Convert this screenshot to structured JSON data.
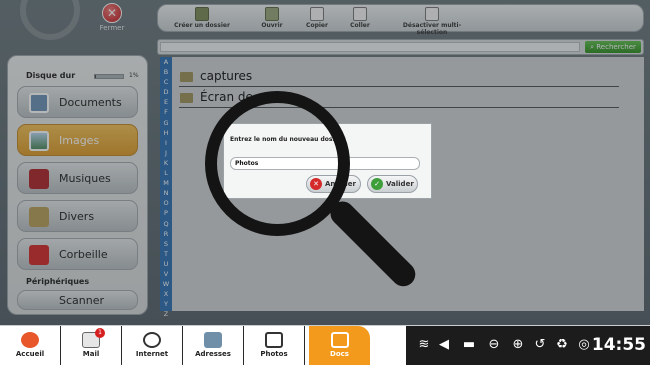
{
  "top": {
    "close_label": "Fermer",
    "toolbar": [
      {
        "label": "Créer un dossier",
        "icon": "new-folder-icon"
      },
      {
        "label": "Ouvrir",
        "icon": "open-icon"
      },
      {
        "label": "Copier",
        "icon": "copy-icon"
      },
      {
        "label": "Coller",
        "icon": "paste-icon"
      },
      {
        "label": "Désactiver multi-sélection",
        "icon": "multi-select-icon"
      }
    ],
    "search": {
      "placeholder": "",
      "button": "Rechercher"
    }
  },
  "sidebar": {
    "disk_label": "Disque dur",
    "disk_percent": "1%",
    "disk_fill": 0.01,
    "items": [
      {
        "label": "Documents",
        "active": false,
        "icon": "documents-icon"
      },
      {
        "label": "Images",
        "active": true,
        "icon": "images-icon"
      },
      {
        "label": "Musiques",
        "active": false,
        "icon": "music-icon"
      },
      {
        "label": "Divers",
        "active": false,
        "icon": "folder-icon"
      },
      {
        "label": "Corbeille",
        "active": false,
        "icon": "trash-icon"
      }
    ],
    "devices_label": "Périphériques",
    "device_partial": "Scanner"
  },
  "alphabet": [
    "A",
    "B",
    "C",
    "D",
    "E",
    "F",
    "G",
    "H",
    "I",
    "J",
    "K",
    "L",
    "M",
    "N",
    "O",
    "P",
    "Q",
    "R",
    "S",
    "T",
    "U",
    "V",
    "W",
    "X",
    "Y",
    "Z"
  ],
  "files": [
    "captures",
    "Écran de"
  ],
  "dialog": {
    "title": "Entrez le nom du nouveau dossier",
    "value": "Photos",
    "cancel": "Annuler",
    "ok": "Valider"
  },
  "taskbar": {
    "apps": [
      {
        "label": "Accueil",
        "icon": "home-icon"
      },
      {
        "label": "Mail",
        "icon": "mail-icon",
        "badge": "1"
      },
      {
        "label": "Internet",
        "icon": "globe-icon"
      },
      {
        "label": "Adresses",
        "icon": "contacts-icon"
      },
      {
        "label": "Photos",
        "icon": "camera-icon"
      },
      {
        "label": "Docs",
        "icon": "docs-icon",
        "active": true
      }
    ],
    "time": "14:55"
  },
  "colors": {
    "accent": "#f39a1c",
    "alpha_strip": "#2e6fb3",
    "search_button": "#3a9e2c"
  }
}
